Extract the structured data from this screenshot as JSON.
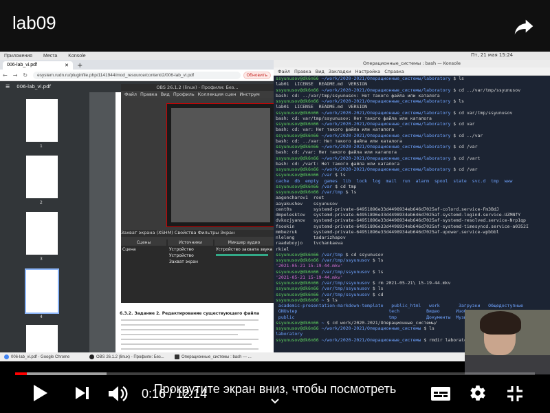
{
  "video": {
    "title": "lab09"
  },
  "gnome": {
    "menu": [
      "Приложения",
      "Места",
      "Konsole"
    ],
    "clock": "Пт, 21 мая 15:24"
  },
  "chrome": {
    "tab_title": "006-lab_vi.pdf",
    "url": "esystem.rudn.ru/pluginfile.php/1141944/mod_resource/content/2/006-lab_vi.pdf",
    "update_label": "Обновить",
    "pdf_title": "006-lab_vi.pdf",
    "page_current": "4",
    "page_total": "5",
    "thumb_numbers": [
      "1",
      "2",
      "3",
      "4"
    ],
    "section_heading": "6.3.2. Задание 2. Редактирование существующего файла"
  },
  "obs": {
    "title": "OBS 26.1.2 (linux) - Профили: Без...",
    "menu": [
      "Файл",
      "Правка",
      "Вид",
      "Профиль",
      "Коллекция сцен",
      "Инструм"
    ],
    "source_bar": "Захват экрана (XSHM)   Свойства   Фильтры   Экран",
    "docks": {
      "scenes": "Сцены",
      "sources": "Источники",
      "mixer": "Микшер аудио"
    },
    "scene_item": "Сцена",
    "sources": [
      "Устройство",
      "Устройство",
      "Захват экран"
    ],
    "mixer_item": "Устройство захвата звука (ALSA)"
  },
  "konsole": {
    "title": "Операционные_системы : bash — Konsole",
    "menu": [
      "Файл",
      "Правка",
      "Вид",
      "Закладки",
      "Настройка",
      "Справка"
    ],
    "lines": [
      [
        "p",
        "ssyunusov@dk6n66 ",
        "~/work/2020-2021/Операционные_системы/laboratory",
        " $ ls"
      ],
      [
        "t",
        "lab01  LICENSE  README.md  VERSION"
      ],
      [
        "p",
        "ssyunusov@dk6n66 ",
        "~/work/2020-2021/Операционные_системы/laboratory",
        " $ cd ../var/tmp/ssyunusov"
      ],
      [
        "t",
        "bash: cd: ../var/tmp/ssyunusov: Нет такого файла или каталога"
      ],
      [
        "p",
        "ssyunusov@dk6n66 ",
        "~/work/2020-2021/Операционные_системы/laboratory",
        " $ ls"
      ],
      [
        "t",
        "lab01  LICENSE  README.md  VERSION"
      ],
      [
        "p",
        "ssyunusov@dk6n66 ",
        "~/work/2020-2021/Операционные_системы/laboratory",
        " $ cd var/tmp/ssyunusov"
      ],
      [
        "t",
        "bash: cd: var/tmp/ssyunusov: Нет такого файла или каталога"
      ],
      [
        "p",
        "ssyunusov@dk6n66 ",
        "~/work/2020-2021/Операционные_системы/laboratory",
        " $ cd var"
      ],
      [
        "t",
        "bash: cd: var: Нет такого файла или каталога"
      ],
      [
        "p",
        "ssyunusov@dk6n66 ",
        "~/work/2020-2021/Операционные_системы/laboratory",
        " $ cd ../var"
      ],
      [
        "t",
        "bash: cd: ../var: Нет такого файла или каталога"
      ],
      [
        "p",
        "ssyunusov@dk6n66 ",
        "~/work/2020-2021/Операционные_системы/laboratory",
        " $ cd /var"
      ],
      [
        "t",
        "bash: cd: /var: Нет такого файла или каталога"
      ],
      [
        "p",
        "ssyunusov@dk6n66 ",
        "~/work/2020-2021/Операционные_системы/laboratory",
        " $ cd /vart"
      ],
      [
        "t",
        "bash: cd: /vart: Нет такого файла или каталога"
      ],
      [
        "p",
        "ssyunusov@dk6n66 ",
        "~/work/2020-2021/Операционные_системы/laboratory",
        " $ cd /var"
      ],
      [
        "p",
        "ssyunusov@dk6n66 ",
        "/var",
        " $ ls"
      ],
      [
        "d",
        "cache  db  empty  games  lib  lock  log  mail  run  alarm  spool  state  svc.d  tmp  www"
      ],
      [
        "p",
        "ssyunusov@dk6n66 ",
        "/var",
        " $ cd tmp"
      ],
      [
        "p",
        "ssyunusov@dk6n66 ",
        "/var/tmp",
        " $ ls"
      ],
      [
        "t",
        "aagoncharov1  root"
      ],
      [
        "t",
        "aayakushev    ssyunusov"
      ],
      [
        "t",
        "cent0s        systemd-private-64951896e33d4498934eb646d7025af-colord.service-Fm3BdJ"
      ],
      [
        "t",
        "dmpelesktov   systemd-private-64951896e33d4498934eb646d7025af-systemd-logind.service-UZMNfY"
      ],
      [
        "t",
        "dvkozjyanov   systemd-private-64951896e33d4498934eb646d7025af-systemd-resolved.service-Nrp1qp"
      ],
      [
        "t",
        "fsookin       systemd-private-64951896e33d4498934eb646d7025af-systemd-timesyncd.service-a0352I"
      ],
      [
        "t",
        "mmbezruk      systemd-private-64951896e33d4498934eb646d7025af-upower.service-wpbbbl"
      ],
      [
        "t",
        "nleleng       tadarizhapov"
      ],
      [
        "t",
        "raadeboyjo    tvchankaeva"
      ],
      [
        "t",
        "rkiel"
      ],
      [
        "p",
        "ssyunusov@dk6n66 ",
        "/var/tmp",
        " $ cd ssyunusov"
      ],
      [
        "p",
        "ssyunusov@dk6n66 ",
        "/var/tmp/ssyunusov",
        " $ ls"
      ],
      [
        "f",
        "'2021-05-21 15-19-44.mkv'"
      ],
      [
        "p",
        "ssyunusov@dk6n66 ",
        "/var/tmp/ssyunusov",
        " $ ls"
      ],
      [
        "f",
        "'2021-05-21 15-19-44.mkv'"
      ],
      [
        "p",
        "ssyunusov@dk6n66 ",
        "/var/tmp/ssyunusov",
        " $ rm 2021-05-21\\ 15-19-44.mkv"
      ],
      [
        "p",
        "ssyunusov@dk6n66 ",
        "/var/tmp/ssyunusov",
        " $ ls"
      ],
      [
        "p",
        "ssyunusov@dk6n66 ",
        "/var/tmp/ssyunusov",
        " $ cd"
      ],
      [
        "p",
        "ssyunusov@dk6n66 ",
        "~",
        " $ ls"
      ],
      [
        "d",
        " academic-presentation-markdown-template   public_html   work       Загрузки   Общедоступные"
      ],
      [
        "d",
        " GNUstep                                  tech          Видео      Изображения"
      ],
      [
        "d",
        " public                                   tmp           Документы  Музыка"
      ],
      [
        "p",
        "ssyunusov@dk6n66 ",
        "~",
        " $ cd work/2020-2021/Операционные_системы/"
      ],
      [
        "p",
        "ssyunusov@dk6n66 ",
        "~/work/2020-2021/Операционные_системы",
        " $ ls"
      ],
      [
        "d",
        "laboratory"
      ],
      [
        "p",
        "ssyunusov@dk6n66 ",
        "~/work/2020-2021/Операционные_системы",
        " $ rmdir laboratory"
      ]
    ]
  },
  "taskbar": [
    "006-lab_vi.pdf - Google Chrome",
    "OBS 26.1.2 (linux) - Профили: Без...",
    "Операционные_системы : bash — ..."
  ],
  "player": {
    "current_time": "0:16",
    "total_time": "12:14",
    "time_display": "0:16 / 12:14",
    "played_fraction": 0.022,
    "loaded_fraction": 0.176,
    "scroll_hint": "Прокрутите экран вниз, чтобы посмотреть"
  },
  "icons": [
    "share-icon",
    "play-icon",
    "next-icon",
    "volume-icon",
    "subtitles-icon",
    "settings-icon",
    "fullscreen-icon",
    "chevron-down-icon"
  ]
}
